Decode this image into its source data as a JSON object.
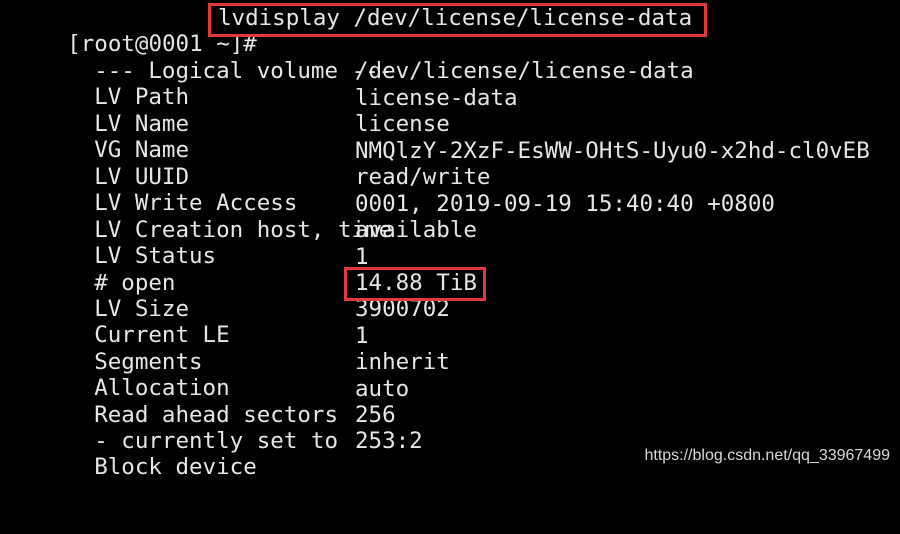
{
  "terminal": {
    "prompt": "[root@0001 ~]#",
    "command": "lvdisplay /dev/license/license-data",
    "header": "--- Logical volume ---",
    "rows": [
      {
        "label": "LV Path",
        "value": "/dev/license/license-data"
      },
      {
        "label": "LV Name",
        "value": "license-data"
      },
      {
        "label": "VG Name",
        "value": "license"
      },
      {
        "label": "LV UUID",
        "value": "NMQlzY-2XzF-EsWW-OHtS-Uyu0-x2hd-cl0vEB"
      },
      {
        "label": "LV Write Access",
        "value": "read/write"
      },
      {
        "label": "LV Creation host, time",
        "value": "0001, 2019-09-19 15:40:40 +0800"
      },
      {
        "label": "LV Status",
        "value": "available"
      },
      {
        "label": "# open",
        "value": "1"
      },
      {
        "label": "LV Size",
        "value": "14.88 TiB"
      },
      {
        "label": "Current LE",
        "value": "3900702"
      },
      {
        "label": "Segments",
        "value": "1"
      },
      {
        "label": "Allocation",
        "value": "inherit"
      },
      {
        "label": "Read ahead sectors",
        "value": "auto"
      },
      {
        "label": "- currently set to",
        "value": "256"
      },
      {
        "label": "Block device",
        "value": "253:2"
      }
    ]
  },
  "watermark": "https://blog.csdn.net/qq_33967499",
  "colors": {
    "background": "#000000",
    "text": "#e6e6e6",
    "highlight_border": "#e03a3a"
  }
}
